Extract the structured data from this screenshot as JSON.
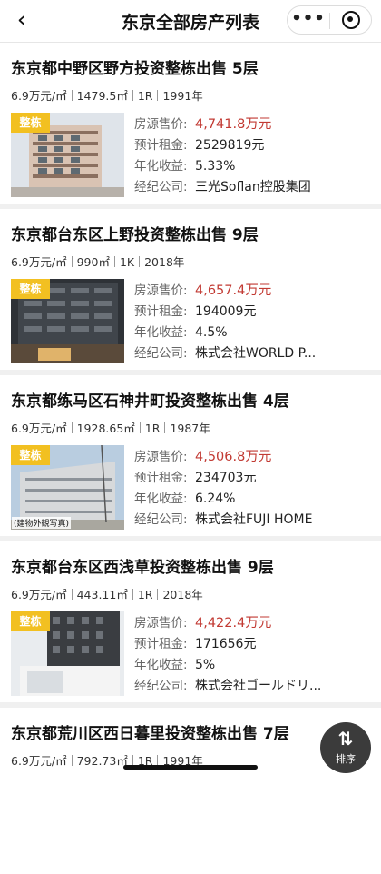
{
  "header": {
    "title": "东京全部房产列表",
    "more_icon": "•••"
  },
  "labels": {
    "price": "房源售价:",
    "rent": "预计租金:",
    "yield": "年化收益:",
    "agent": "经纪公司:"
  },
  "listings": [
    {
      "title": "东京都中野区野方投资整栋出售 5层",
      "meta": [
        "6.9万元/㎡",
        "1479.5㎡",
        "1R",
        "1991年"
      ],
      "tag": "整栋",
      "price": "4,741.8万元",
      "rent": "2529819元",
      "yield": "5.33%",
      "agent": "三光Soflan控股集团"
    },
    {
      "title": "东京都台东区上野投资整栋出售 9层",
      "meta": [
        "6.9万元/㎡",
        "990㎡",
        "1K",
        "2018年"
      ],
      "tag": "整栋",
      "price": "4,657.4万元",
      "rent": "194009元",
      "yield": "4.5%",
      "agent": "株式会社WORLD P..."
    },
    {
      "title": "东京都练马区石神井町投资整栋出售 4层",
      "meta": [
        "6.9万元/㎡",
        "1928.65㎡",
        "1R",
        "1987年"
      ],
      "tag": "整栋",
      "image_caption": "(建物外観写真)",
      "price": "4,506.8万元",
      "rent": "234703元",
      "yield": "6.24%",
      "agent": "株式会社FUJI HOME"
    },
    {
      "title": "东京都台东区西浅草投资整栋出售 9层",
      "meta": [
        "6.9万元/㎡",
        "443.11㎡",
        "1R",
        "2018年"
      ],
      "tag": "整栋",
      "price": "4,422.4万元",
      "rent": "171656元",
      "yield": "5%",
      "agent": "株式会社ゴールドリ..."
    },
    {
      "title": "东京都荒川区西日暮里投资整栋出售 7层",
      "meta": [
        "6.9万元/㎡",
        "792.73㎡",
        "1R",
        "1991年"
      ]
    }
  ],
  "sort_button": {
    "label": "排序",
    "icon": "sort-arrows-icon"
  },
  "colors": {
    "price": "#c23a33",
    "tag": "#f2c021",
    "sort_bg": "#3b3b3b"
  }
}
